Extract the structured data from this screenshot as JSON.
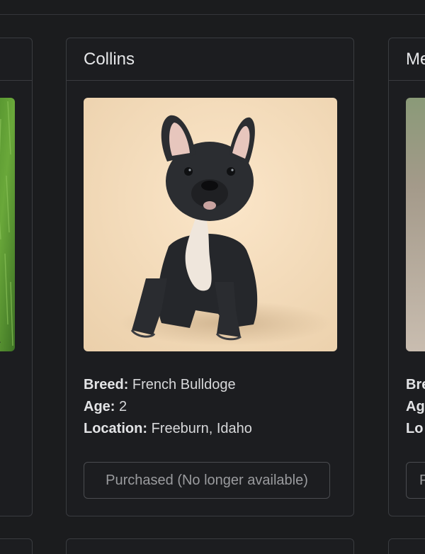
{
  "cards": {
    "main": {
      "name": "Collins",
      "photo_alt": "French bulldog puppy",
      "breed_label": "Breed:",
      "breed": "French Bulldoge",
      "age_label": "Age:",
      "age": "2",
      "location_label": "Location:",
      "location": "Freeburn, Idaho",
      "status_button": "Purchased (No longer available)"
    },
    "right_partial": {
      "name_fragment": "Me",
      "breed_fragment": "Bre",
      "age_fragment": "Ag",
      "location_fragment": "Lo",
      "button_fragment": "P"
    }
  },
  "colors": {
    "background": "#1b1c1e",
    "card_border": "#3a3c40",
    "photo_bg": "#f3ddbd"
  }
}
